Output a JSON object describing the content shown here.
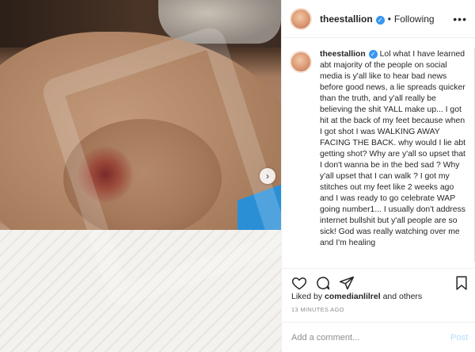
{
  "post": {
    "username": "theestallion",
    "follow_status": "Following",
    "more_label": "•••",
    "next_arrow": "›"
  },
  "caption": {
    "username": "theestallion",
    "text": "Lol what I have learned abt majority of the people on social media is y'all like to hear bad news before good news, a lie spreads quicker than the truth, and y'all really be believing the shit YALL make up... I got hit at the back of my feet because when I got shot I was WALKING AWAY FACING THE BACK. why would I lie abt getting shot? Why are y'all so upset that I don't wanna be in the bed sad ? Why y'all upset that I can walk ? I got my stitches out my feet like 2 weeks ago and I was ready to go celebrate WAP going number1... I usually don't address internet bullshit but y'all people are so sick! God was really watching over me and I'm healing"
  },
  "likes": {
    "prefix": "Liked by",
    "liker": "comedianlilrel",
    "suffix": "and others"
  },
  "timestamp": "13 MINUTES AGO",
  "comment": {
    "placeholder": "Add a comment...",
    "post_label": "Post"
  },
  "icons": {
    "like": "heart-icon",
    "comment": "comment-icon",
    "share": "share-icon",
    "save": "bookmark-icon",
    "verified": "verified-badge-icon",
    "more": "more-options-icon"
  },
  "colors": {
    "verified": "#3897f0",
    "post_disabled": "#b3dbff",
    "secondary_text": "#8e8e8e"
  }
}
